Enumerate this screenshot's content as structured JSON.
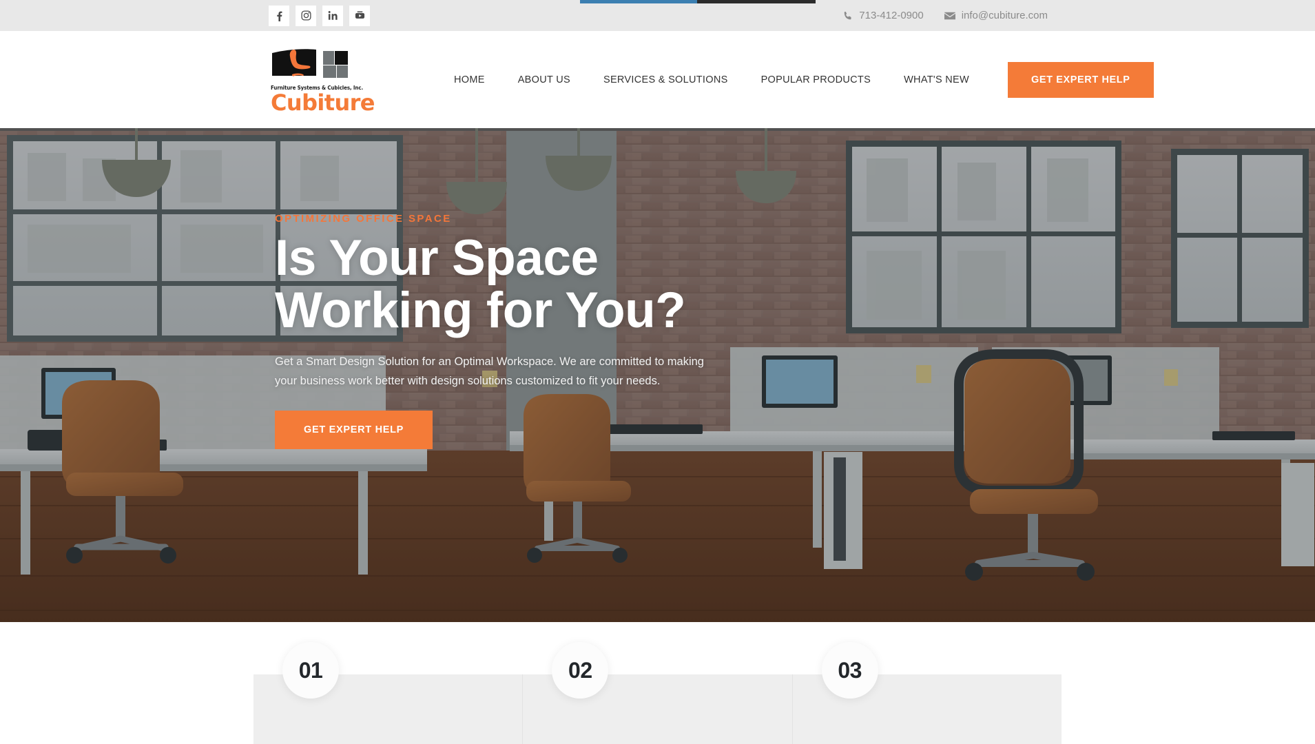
{
  "browser": {
    "loading_bar": {
      "visible": true,
      "progress_color": "#3c7fb1",
      "track_color": "#2b2b2b"
    }
  },
  "topbar": {
    "background": "#e8e8e8",
    "social": [
      {
        "name": "facebook",
        "label": "f"
      },
      {
        "name": "instagram",
        "label": "Instagram"
      },
      {
        "name": "linkedin",
        "label": "in"
      },
      {
        "name": "youtube",
        "label": "YouTube"
      }
    ],
    "phone": "713-412-0900",
    "email": "info@cubiture.com"
  },
  "header": {
    "logo": {
      "tagline": "Furniture Systems & Cubicles, Inc.",
      "wordmark": "Cubiture",
      "accent": "#f47b38"
    },
    "nav": [
      {
        "label": "HOME"
      },
      {
        "label": "ABOUT US"
      },
      {
        "label": "SERVICES & SOLUTIONS"
      },
      {
        "label": "POPULAR PRODUCTS"
      },
      {
        "label": "WHAT'S NEW"
      }
    ],
    "cta_label": "GET EXPERT HELP",
    "cta_color": "#f47b38"
  },
  "hero": {
    "eyebrow": "OPTIMIZING OFFICE SPACE",
    "title_line1": "Is Your Space",
    "title_line2": "Working for You?",
    "paragraph": "Get a Smart Design Solution for an Optimal Workspace. We are committed to making your business work better with design solutions customized to fit your needs.",
    "cta_label": "GET EXPERT HELP",
    "scene": "open-plan office with exposed brick walls, industrial windows, pendant lamps, white desks, tan leather task chairs and hardwood floor"
  },
  "features": {
    "items": [
      {
        "number": "01"
      },
      {
        "number": "02"
      },
      {
        "number": "03"
      }
    ]
  }
}
